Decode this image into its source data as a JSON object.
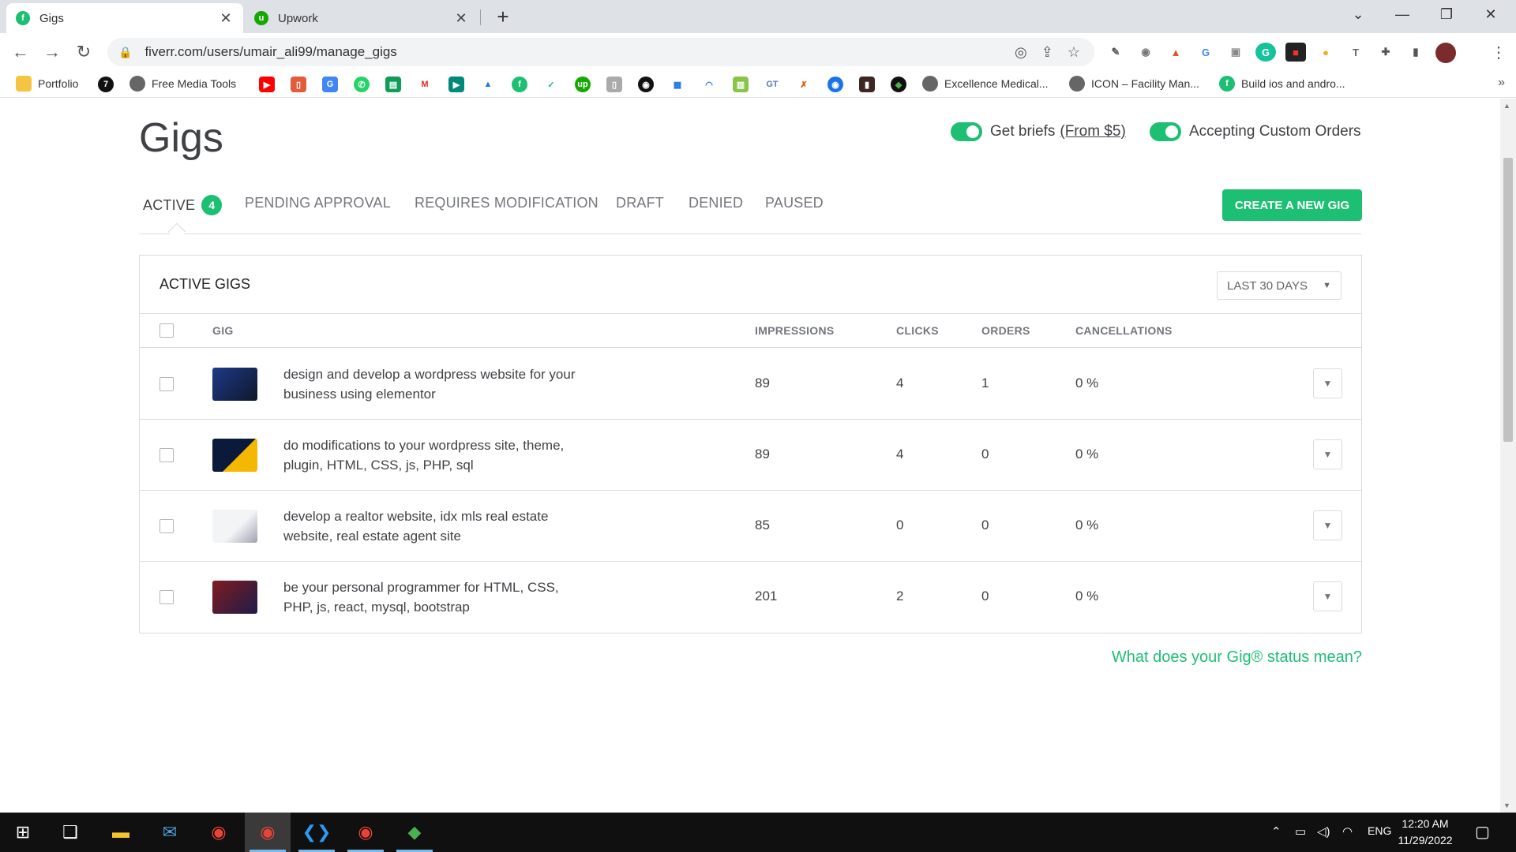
{
  "browser": {
    "tabs": [
      {
        "title": "Gigs",
        "active": true
      },
      {
        "title": "Upwork",
        "active": false
      }
    ],
    "url": "fiverr.com/users/umair_ali99/manage_gigs",
    "bookmarks": {
      "portfolio": "Portfolio",
      "free_media_tools": "Free Media Tools",
      "excellence": "Excellence Medical...",
      "icon_facility": "ICON – Facility Man...",
      "build_ios": "Build ios and andro..."
    }
  },
  "page": {
    "title": "Gigs",
    "get_briefs_label": "Get briefs",
    "get_briefs_link": "(From $5)",
    "custom_orders_label": "Accepting Custom Orders",
    "tabs": [
      {
        "label": "ACTIVE",
        "count": "4"
      },
      {
        "label": "PENDING APPROVAL"
      },
      {
        "label": "REQUIRES MODIFICATION"
      },
      {
        "label": "DRAFT"
      },
      {
        "label": "DENIED"
      },
      {
        "label": "PAUSED"
      }
    ],
    "create_button": "CREATE A NEW GIG",
    "card_title": "ACTIVE GIGS",
    "period": "LAST 30 DAYS",
    "columns": {
      "gig": "GIG",
      "impressions": "IMPRESSIONS",
      "clicks": "CLICKS",
      "orders": "ORDERS",
      "cancellations": "CANCELLATIONS"
    },
    "gigs": [
      {
        "title": "design and develop a wordpress website for your business using elementor",
        "impressions": "89",
        "clicks": "4",
        "orders": "1",
        "cancellations": "0 %"
      },
      {
        "title": "do modifications to your wordpress site, theme, plugin, HTML, CSS, js, PHP, sql",
        "impressions": "89",
        "clicks": "4",
        "orders": "0",
        "cancellations": "0 %"
      },
      {
        "title": "develop a realtor website, idx mls real estate website, real estate agent site",
        "impressions": "85",
        "clicks": "0",
        "orders": "0",
        "cancellations": "0 %"
      },
      {
        "title": "be your personal programmer for HTML, CSS, PHP, js, react, mysql, bootstrap",
        "impressions": "201",
        "clicks": "2",
        "orders": "0",
        "cancellations": "0 %"
      }
    ],
    "status_link": "What does your Gig® status mean?"
  },
  "taskbar": {
    "language": "ENG",
    "time": "12:20 AM",
    "date": "11/29/2022"
  },
  "colors": {
    "accent": "#1dbf73",
    "text": "#404145",
    "muted": "#74767e",
    "border": "#dadbdd"
  }
}
